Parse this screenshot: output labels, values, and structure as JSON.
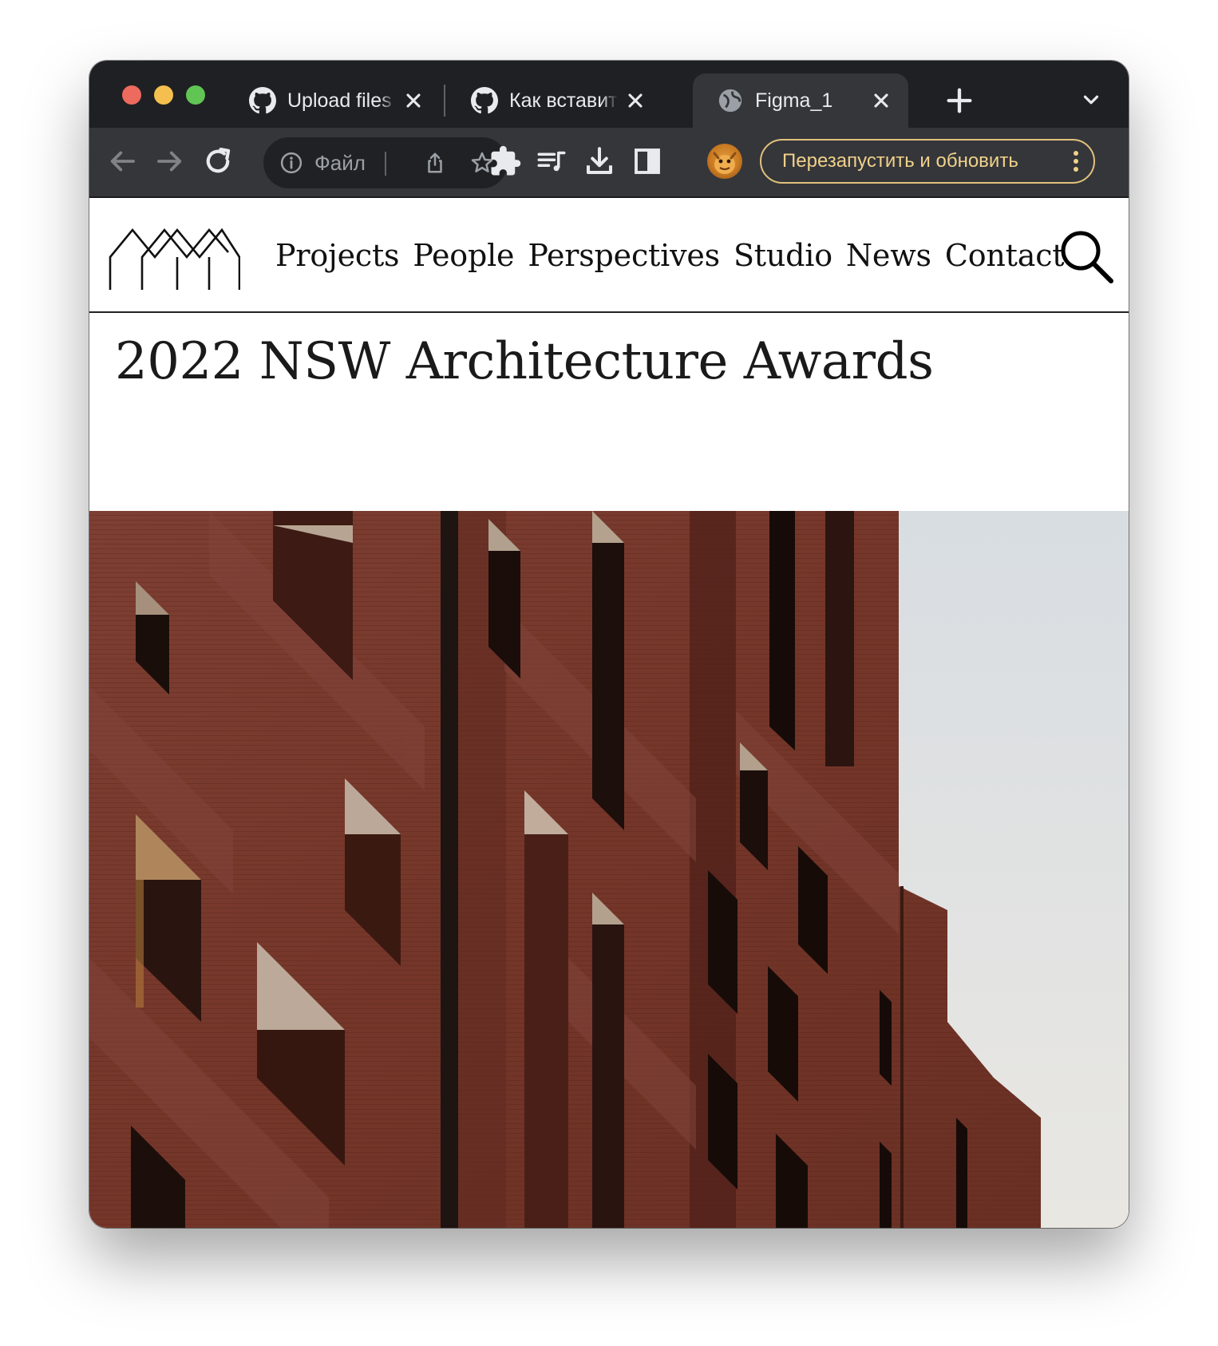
{
  "browser": {
    "tabs": [
      {
        "title": "Upload files · ",
        "favicon": "github-icon",
        "active": false
      },
      {
        "title": "Как вставить изображение",
        "favicon": "github-icon",
        "active": false
      },
      {
        "title": "Figma_1",
        "favicon": "globe-icon",
        "active": true
      }
    ],
    "omnibox": {
      "url_text": "Файл",
      "info_icon": "info-icon"
    },
    "update_button": "Перезапустить и обновить",
    "colors": {
      "frame": "#1f2023",
      "toolbar": "#35363a",
      "omnibox": "#202124",
      "update_accent": "#e1c27c"
    }
  },
  "site": {
    "logo": "house-roofs-logo",
    "nav": [
      "Projects",
      "People",
      "Perspectives",
      "Studio",
      "News",
      "Contact"
    ],
    "search_icon": "search-icon",
    "page_title": "2022 NSW Architecture Awards",
    "hero_image": "red-brick-apartment-facade-photo",
    "colors": {
      "text": "#111111",
      "brick": "#7a3b2f",
      "sky": "#dde1e4"
    }
  }
}
